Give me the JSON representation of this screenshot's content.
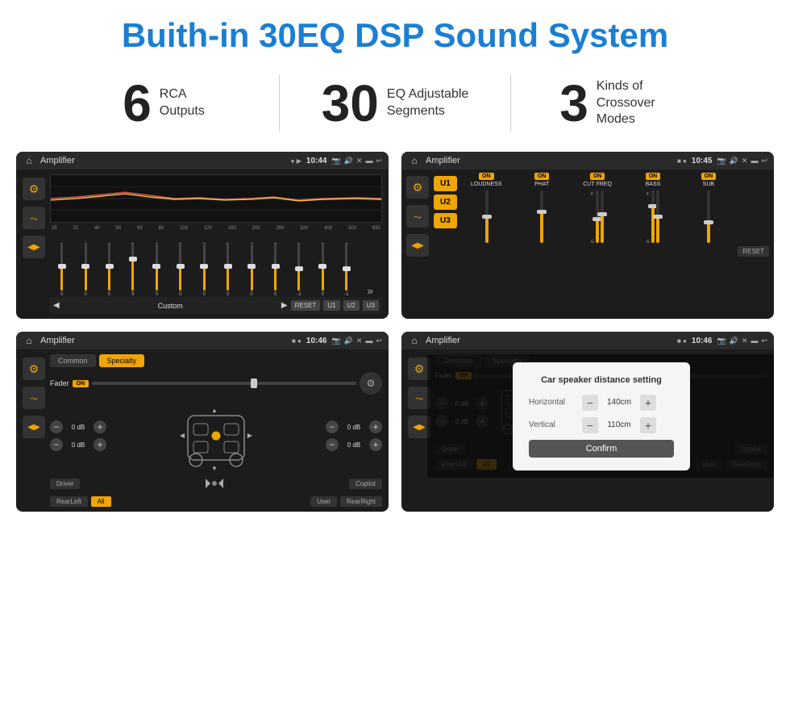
{
  "header": {
    "title": "Buith-in 30EQ DSP Sound System"
  },
  "stats": [
    {
      "number": "6",
      "text": "RCA\nOutputs"
    },
    {
      "number": "30",
      "text": "EQ Adjustable\nSegments"
    },
    {
      "number": "3",
      "text": "Kinds of\nCrossover Modes"
    }
  ],
  "screens": {
    "eq": {
      "title": "Amplifier",
      "time": "10:44",
      "freqs": [
        "25",
        "32",
        "40",
        "50",
        "63",
        "80",
        "100",
        "125",
        "160",
        "200",
        "250",
        "320",
        "400",
        "500",
        "630"
      ],
      "values": [
        "0",
        "0",
        "0",
        "5",
        "0",
        "0",
        "0",
        "0",
        "0",
        "0",
        "-1",
        "0",
        "-1"
      ],
      "preset": "Custom",
      "buttons": [
        "U1",
        "U2",
        "U3",
        "RESET"
      ]
    },
    "crossover": {
      "title": "Amplifier",
      "time": "10:45",
      "presets": [
        "U1",
        "U2",
        "U3"
      ],
      "channels": [
        {
          "name": "LOUDNESS",
          "on": true
        },
        {
          "name": "PHAT",
          "on": true
        },
        {
          "name": "CUT FREQ",
          "on": true
        },
        {
          "name": "BASS",
          "on": true
        },
        {
          "name": "SUB",
          "on": true
        }
      ],
      "reset": "RESET"
    },
    "fader": {
      "title": "Amplifier",
      "time": "10:46",
      "tabs": [
        "Common",
        "Specialty"
      ],
      "fader_label": "Fader",
      "on_label": "ON",
      "volumes": [
        "0 dB",
        "0 dB",
        "0 dB",
        "0 dB"
      ],
      "presets": [
        "Driver",
        "Copilot",
        "RearLeft",
        "All",
        "User",
        "RearRight"
      ]
    },
    "distance": {
      "title": "Amplifier",
      "time": "10:46",
      "tabs": [
        "Common",
        "Specialty"
      ],
      "modal": {
        "title": "Car speaker distance setting",
        "horizontal_label": "Horizontal",
        "horizontal_value": "140cm",
        "vertical_label": "Vertical",
        "vertical_value": "110cm",
        "confirm_label": "Confirm"
      },
      "volumes": [
        "0 dB",
        "0 dB"
      ],
      "presets": [
        "Driver",
        "Copilot",
        "RearLeft",
        "All",
        "User",
        "RearRight"
      ]
    }
  }
}
